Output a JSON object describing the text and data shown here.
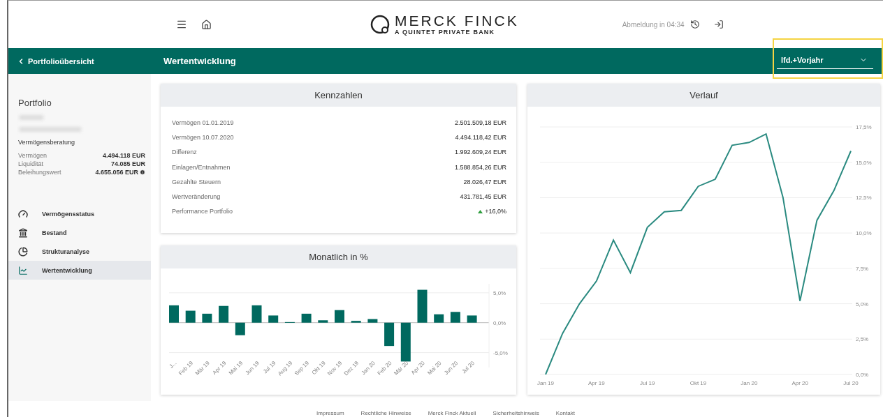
{
  "header": {
    "logo": {
      "name": "MERCK FINCK",
      "tagline": "A QUINTET PRIVATE BANK"
    },
    "session": "Abmeldung in 04:34"
  },
  "toolbar": {
    "back": "Portfolioübersicht",
    "title": "Wertentwicklung",
    "period": "lfd.+Vorjahr"
  },
  "sidebar": {
    "title": "Portfolio",
    "subtitle": "Vermögensberatung",
    "figures": [
      {
        "label": "Vermögen",
        "value": "4.494.118 EUR",
        "info": false
      },
      {
        "label": "Liquidität",
        "value": "74.085 EUR",
        "info": false
      },
      {
        "label": "Beleihungswert",
        "value": "4.655.056 EUR",
        "info": true
      }
    ],
    "nav": [
      {
        "label": "Vermögensstatus",
        "kind": "gauge",
        "selected": false
      },
      {
        "label": "Bestand",
        "kind": "bank",
        "selected": false
      },
      {
        "label": "Strukturanalyse",
        "kind": "pie",
        "selected": false
      },
      {
        "label": "Wertentwicklung",
        "kind": "chart",
        "selected": true
      }
    ]
  },
  "kennzahlen": {
    "title": "Kennzahlen",
    "rows": [
      {
        "label": "Vermögen 01.01.2019",
        "value": "2.501.509,18 EUR"
      },
      {
        "label": "Vermögen 10.07.2020",
        "value": "4.494.118,42 EUR"
      },
      {
        "label": "Differenz",
        "value": "1.992.609,24 EUR"
      },
      {
        "label": "Einlagen/Entnahmen",
        "value": "1.588.854,26 EUR"
      },
      {
        "label": "Gezahlte Steuern",
        "value": "28.026,47 EUR"
      },
      {
        "label": "Wertveränderung",
        "value": "431.781,45 EUR"
      },
      {
        "label": "Performance Portfolio",
        "value": "+16,0%",
        "positive": true
      }
    ]
  },
  "monthly": {
    "title": "Monatlich in %",
    "chart_data": {
      "type": "bar",
      "categories": [
        "J...",
        "Feb 19",
        "Mär 19",
        "Apr 19",
        "Mai 19",
        "Jun 19",
        "Jul 19",
        "Aug 19",
        "Sep 19",
        "Okt 19",
        "Nov 19",
        "Dez 19",
        "Jan 20",
        "Feb 20",
        "Mär 20",
        "Apr 20",
        "Mai 20",
        "Jun 20",
        "Jul 20"
      ],
      "ylim": [
        -7.5,
        6.5
      ],
      "grid": true,
      "series": [
        {
          "color": "#00695f",
          "values": [
            2.9,
            2.0,
            1.5,
            2.8,
            -2.1,
            2.9,
            1.2,
            0.1,
            1.5,
            0.4,
            2.1,
            0.3,
            0.6,
            -3.9,
            -6.5,
            5.5,
            1.4,
            1.8,
            1.2
          ]
        }
      ],
      "yticks": [
        {
          "value": 5,
          "label": "5,0%"
        },
        {
          "value": 0,
          "label": "0,0%"
        },
        {
          "value": -5,
          "label": "-5,0%"
        }
      ]
    }
  },
  "verlauf": {
    "title": "Verlauf",
    "chart_data": {
      "type": "line",
      "categories": [
        "Jan 19",
        null,
        null,
        "Apr 19",
        null,
        null,
        "Jul 19",
        null,
        null,
        "Okt 19",
        null,
        null,
        "Jan 20",
        null,
        null,
        "Apr 20",
        null,
        null,
        "Jul 20"
      ],
      "grid": true,
      "series": [
        {
          "color": "#2a8a80",
          "values": [
            0,
            2.9,
            5.0,
            6.6,
            9.5,
            7.2,
            10.4,
            11.5,
            11.6,
            13.3,
            13.8,
            16.2,
            16.4,
            17.0,
            12.5,
            5.2,
            10.9,
            13.0,
            15.8
          ]
        }
      ],
      "ylim": [
        0,
        17.5
      ],
      "yticks": [
        {
          "value": 0,
          "label": "0,0%"
        },
        {
          "value": 2.5,
          "label": "2,5%"
        },
        {
          "value": 5,
          "label": "5,0%"
        },
        {
          "value": 7.5,
          "label": "7,5%"
        },
        {
          "value": 10,
          "label": "10,0%"
        },
        {
          "value": 12.5,
          "label": "12,5%"
        },
        {
          "value": 15,
          "label": "15,0%"
        },
        {
          "value": 17.5,
          "label": "17,5%"
        }
      ]
    }
  },
  "footer": [
    "Impressum",
    "Rechtliche Hinweise",
    "Merck Finck Aktuell",
    "Sicherheitshinweis",
    "Kontakt"
  ]
}
